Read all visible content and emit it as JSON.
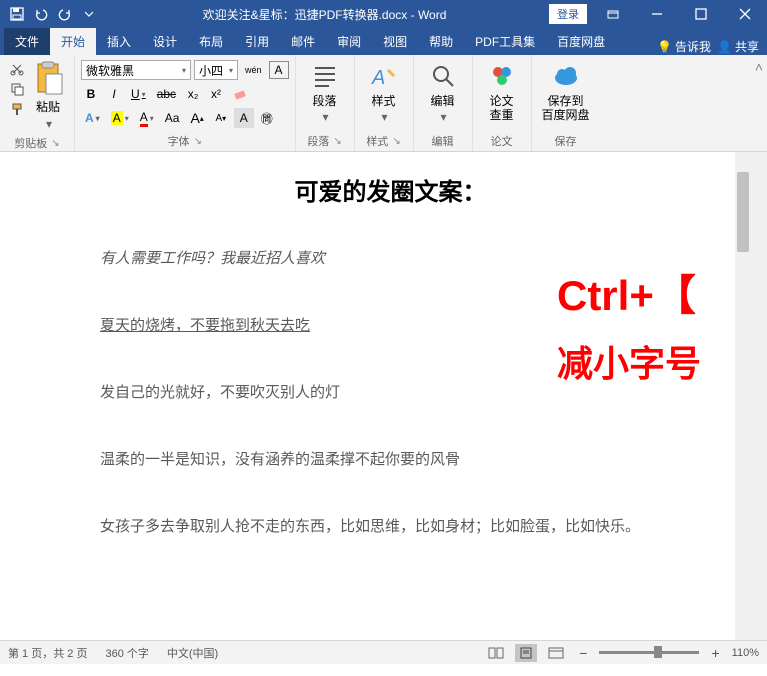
{
  "titlebar": {
    "center": "欢迎关注&星标：迅捷PDF转换器.docx - Word",
    "login": "登录"
  },
  "tabs": {
    "file": "文件",
    "home": "开始",
    "insert": "插入",
    "design": "设计",
    "layout": "布局",
    "references": "引用",
    "mailings": "邮件",
    "review": "审阅",
    "view": "视图",
    "help": "帮助",
    "pdf": "PDF工具集",
    "baidu": "百度网盘",
    "tellme": "告诉我",
    "share": "共享"
  },
  "ribbon": {
    "clipboard": {
      "label": "剪贴板",
      "paste": "粘贴"
    },
    "font": {
      "label": "字体",
      "name": "微软雅黑",
      "size": "小四",
      "wen": "wén",
      "bold": "B",
      "italic": "I",
      "underline": "U",
      "strike": "abc",
      "sub": "x₂",
      "sup": "x²",
      "fontcolor": "A",
      "highlight": "A",
      "charborder": "A",
      "phonetic": "Aa",
      "grow": "A",
      "shrink": "A",
      "charshade": "A",
      "circled": "㉄"
    },
    "paragraph": {
      "label": "段落",
      "btn": "段落"
    },
    "styles": {
      "label": "样式",
      "btn": "样式"
    },
    "editing": {
      "label": "编辑",
      "btn": "编辑"
    },
    "thesis": {
      "label": "论文",
      "btn": "论文\n查重"
    },
    "save": {
      "label": "保存",
      "btn": "保存到\n百度网盘"
    }
  },
  "document": {
    "title": "可爱的发圈文案：",
    "line1": "有人需要工作吗？我最近招人喜欢",
    "line2": "夏天的烧烤，不要拖到秋天去吃",
    "line3": "发自己的光就好，不要吹灭别人的灯",
    "line4": "温柔的一半是知识，没有涵养的温柔撑不起你要的风骨",
    "line5": "女孩子多去争取别人抢不走的东西，比如思维，比如身材；比如脸蛋，比如快乐。"
  },
  "annotation": {
    "line1": "Ctrl+【",
    "line2": "减小字号"
  },
  "statusbar": {
    "page": "第 1 页，共 2 页",
    "words": "360 个字",
    "lang": "中文(中国)",
    "zoom": "110%"
  }
}
